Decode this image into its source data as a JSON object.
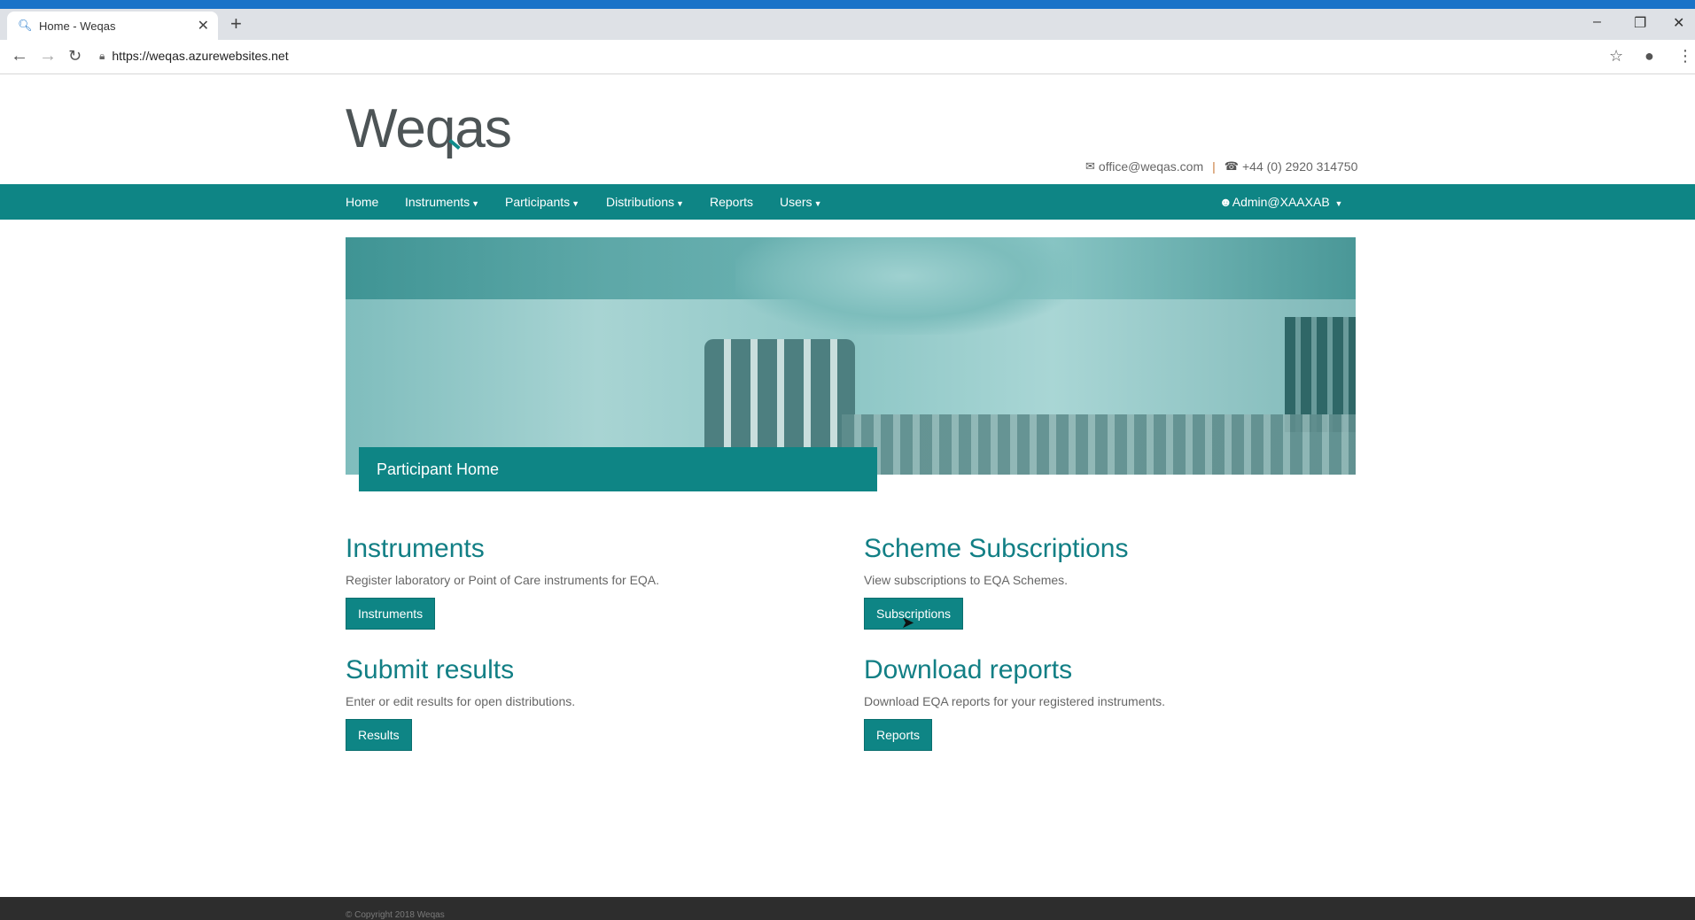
{
  "browser": {
    "tab_title": "Home - Weqas",
    "tab_close": "✕",
    "new_tab": "+",
    "url": "https://weqas.azurewebsites.net",
    "window_controls": {
      "minimize": "–",
      "restore": "❐",
      "close": "✕"
    }
  },
  "header": {
    "logo_text_1": "We",
    "logo_text_2": "q",
    "logo_text_3": "as",
    "email": "office@weqas.com",
    "separator": "|",
    "phone": "+44 (0) 2920 314750"
  },
  "nav": {
    "items": [
      {
        "label": "Home"
      },
      {
        "label": "Instruments"
      },
      {
        "label": "Participants"
      },
      {
        "label": "Distributions"
      },
      {
        "label": "Reports"
      },
      {
        "label": "Users"
      }
    ],
    "user": "Admin@XAAXAB"
  },
  "hero": {
    "caption": "Participant Home"
  },
  "sections": {
    "instruments": {
      "title": "Instruments",
      "desc": "Register laboratory or Point of Care instruments for EQA.",
      "button": "Instruments"
    },
    "subscriptions": {
      "title": "Scheme Subscriptions",
      "desc": "View subscriptions to EQA Schemes.",
      "button": "Subscriptions"
    },
    "results": {
      "title": "Submit results",
      "desc": "Enter or edit results for open distributions.",
      "button": "Results"
    },
    "reports": {
      "title": "Download reports",
      "desc": "Download EQA reports for your registered instruments.",
      "button": "Reports"
    }
  },
  "footer": {
    "copyright": "© Copyright 2018 Weqas"
  },
  "colors": {
    "brand": "#0e8585",
    "heading": "#127f85",
    "chrome_accent": "#1a73c8"
  }
}
